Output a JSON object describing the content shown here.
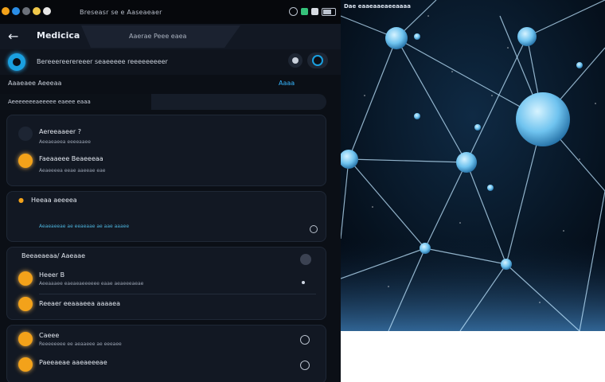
{
  "status_bar": {
    "title": "Breseasr se e Aaseaeaer",
    "icons": [
      "app-icon-orange",
      "app-icon-blue",
      "app-icon-gray",
      "app-icon-yellow",
      "app-icon-white"
    ],
    "right_icons": [
      "link-icon",
      "signal-icon",
      "wifi-icon",
      "battery-icon"
    ]
  },
  "toolbar": {
    "back_icon": "←",
    "title": "Medicica",
    "subtitle": "Aaerae Peee eaea"
  },
  "search": {
    "text": "Bereeereerereeer seaeeeee reeeeeeeeer"
  },
  "info_row": {
    "left": "Aaaeaee Aeeeaa",
    "right": "Aaaa"
  },
  "section": {
    "label": "Aeeeeeeeaeeeee eaeee eaaa"
  },
  "cards": {
    "a": {
      "item1_title": "Aereeaaeer ?",
      "item1_sub": "Aeeaeaeea eeeeaaee",
      "item2_title": "Faeaaeee Beaeeeaa",
      "item2_sub": "Aeaeeeea eeae aaeeae eae"
    },
    "b": {
      "title": "Heeaa aeeeea",
      "sub": "Aeaeaeeae ae eeaeaae ae aae aaaee"
    },
    "c": {
      "header": "Beeaeaeaa/ Aaeaae",
      "item1_title": "Heeer B",
      "item1_sub": "Aeeaaaee eaeaeaeeeeee eaae aeaeeeaeae",
      "item2_title": "Reeaer eeaaaeea aaaaea"
    },
    "d": {
      "item1_title": "Caeee",
      "item1_sub": "Reeeeeeee ee aeaaeee ae eeeaee",
      "item2_title": "Paeeaeae aaeaeeeae"
    }
  },
  "image_panel": {
    "caption": "Dae eaaeaaeaeeaaaa"
  },
  "colors": {
    "accent_blue": "#1aa0e0",
    "accent_orange": "#f3a21a",
    "panel_bg": "#0b0f16",
    "card_bg": "#121823"
  }
}
